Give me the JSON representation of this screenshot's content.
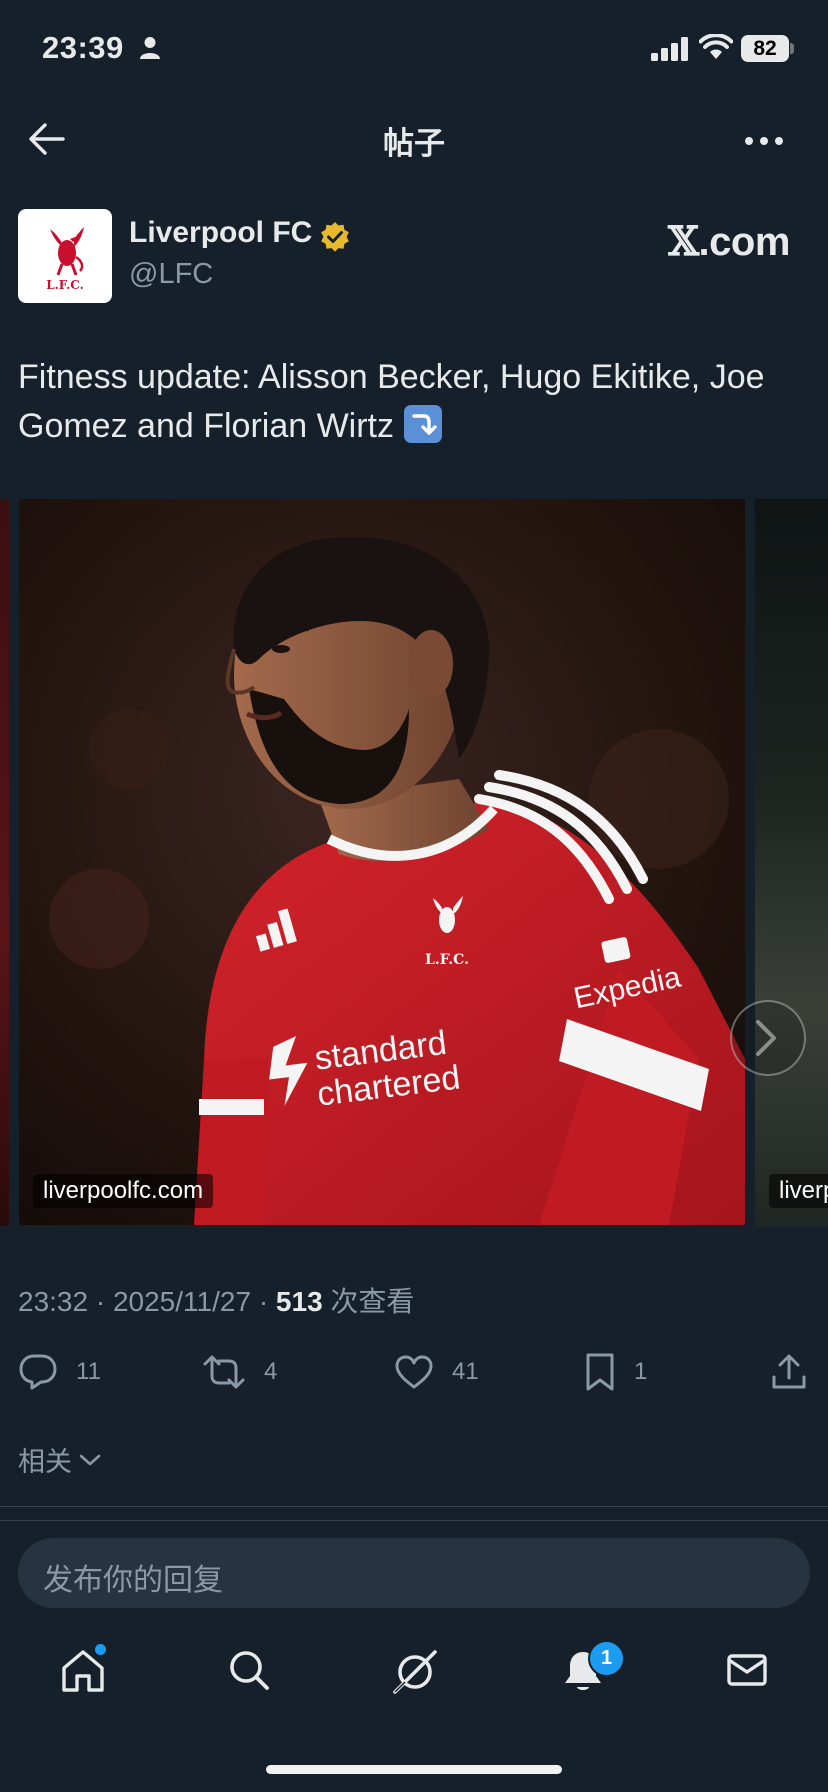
{
  "status_bar": {
    "time": "23:39",
    "battery": "82"
  },
  "nav": {
    "title": "帖子"
  },
  "author": {
    "name": "Liverpool FC",
    "handle": "@LFC",
    "logo_text": "L.F.C."
  },
  "source_badge": {
    "x": "𝕏",
    "rest": ".com"
  },
  "tweet": {
    "text": "Fitness update: Alisson Becker, Hugo Ekitike, Joe Gomez and Florian Wirtz"
  },
  "media": {
    "watermark": "liverpoolfc.com",
    "watermark_next": "liverp",
    "shirt_text_1": "standard",
    "shirt_text_2": "chartered",
    "sleeve_text": "Expedia",
    "crest_text": "L.F.C."
  },
  "meta": {
    "time": "23:32",
    "date": "2025/11/27",
    "views": "513",
    "views_label": "次查看",
    "sep": "·"
  },
  "actions": {
    "replies": "11",
    "reposts": "4",
    "likes": "41",
    "bookmarks": "1"
  },
  "related_label": "相关",
  "reply": {
    "placeholder": "发布你的回复"
  },
  "tabbar": {
    "notifications_badge": "1"
  },
  "colors": {
    "background": "#15202b",
    "accent": "#1d9bf0",
    "lfc_red": "#c8102e",
    "verified_gold": "#e8b92c"
  }
}
